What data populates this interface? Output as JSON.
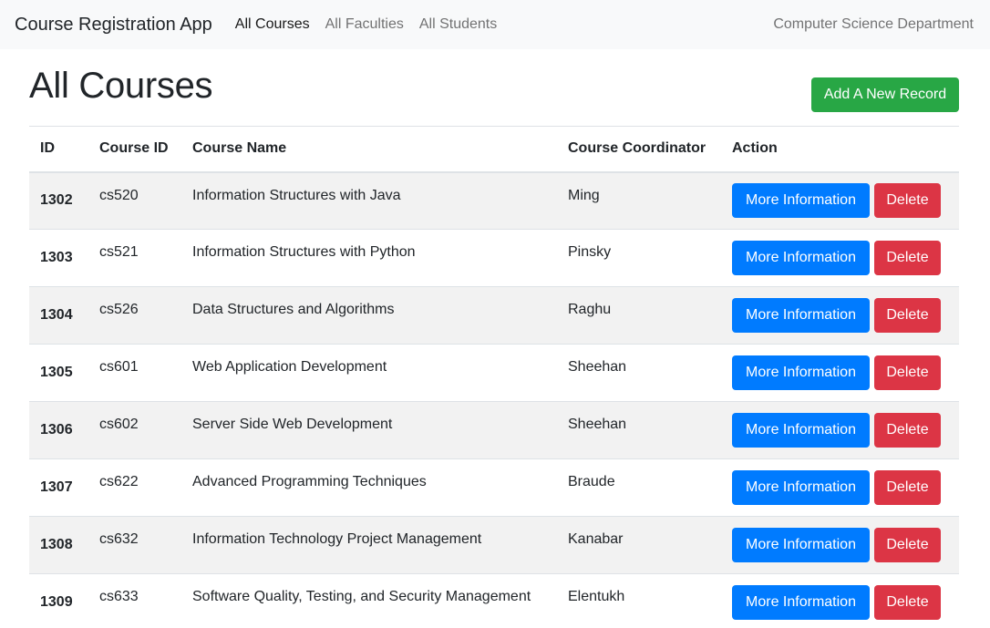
{
  "navbar": {
    "brand": "Course Registration App",
    "links": [
      "All Courses",
      "All Faculties",
      "All Students"
    ],
    "active_link": "All Courses",
    "right_text": "Computer Science Department"
  },
  "page": {
    "title": "All Courses",
    "add_button": "Add A New Record"
  },
  "table": {
    "headers": [
      "ID",
      "Course ID",
      "Course Name",
      "Course Coordinator",
      "Action"
    ],
    "rows": [
      {
        "id": "1302",
        "course_id": "cs520",
        "name": "Information Structures with Java",
        "coordinator": "Ming"
      },
      {
        "id": "1303",
        "course_id": "cs521",
        "name": "Information Structures with Python",
        "coordinator": "Pinsky"
      },
      {
        "id": "1304",
        "course_id": "cs526",
        "name": "Data Structures and Algorithms",
        "coordinator": "Raghu"
      },
      {
        "id": "1305",
        "course_id": "cs601",
        "name": "Web Application Development",
        "coordinator": "Sheehan"
      },
      {
        "id": "1306",
        "course_id": "cs602",
        "name": "Server Side Web Development",
        "coordinator": "Sheehan"
      },
      {
        "id": "1307",
        "course_id": "cs622",
        "name": "Advanced Programming Techniques",
        "coordinator": "Braude"
      },
      {
        "id": "1308",
        "course_id": "cs632",
        "name": "Information Technology Project Management",
        "coordinator": "Kanabar"
      },
      {
        "id": "1309",
        "course_id": "cs633",
        "name": "Software Quality, Testing, and Security Management",
        "coordinator": "Elentukh"
      }
    ],
    "info_button": "More Information",
    "delete_button": "Delete"
  },
  "colors": {
    "navbar_bg": "#f8f9fa",
    "success": "#28a745",
    "primary": "#007bff",
    "danger": "#dc3545",
    "stripe": "#f2f2f2"
  }
}
